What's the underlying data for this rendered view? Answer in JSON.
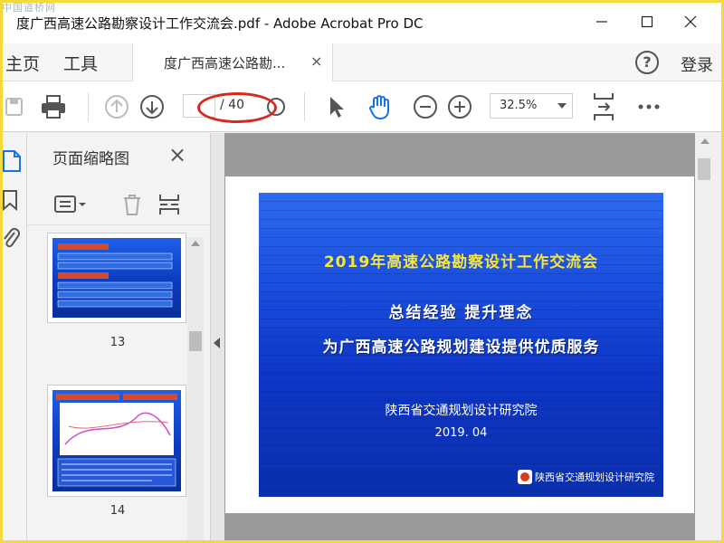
{
  "window": {
    "watermark": "中国道桥网",
    "title": "度广西高速公路勘察设计工作交流会.pdf - Adobe Acrobat Pro DC",
    "minimize_icon": "minimize-icon",
    "maximize_icon": "maximize-icon",
    "close_icon": "close-icon"
  },
  "menu": {
    "home": "主页",
    "tools": "工具",
    "doc_tab_label": "度广西高速公路勘...",
    "doc_tab_close": "×",
    "help": "?",
    "login": "登录"
  },
  "toolbar": {
    "page_current": "",
    "page_total": "/ 40",
    "zoom": "32.5%",
    "icons": [
      "save-icon",
      "print-icon",
      "prev-page-icon",
      "next-page-icon",
      "select-cursor-icon",
      "hand-tool-icon",
      "zoom-out-icon",
      "zoom-in-icon",
      "fit-page-icon",
      "more-icon"
    ]
  },
  "side_panel": {
    "title": "页面缩略图",
    "close": "×",
    "thumbnails": [
      {
        "page": "13"
      },
      {
        "page": "14"
      }
    ]
  },
  "slide": {
    "heading": "2019年高速公路勘察设计工作交流会",
    "subtitle_line1": "总结经验  提升理念",
    "subtitle_line2": "为广西高速公路规划建设提供优质服务",
    "organization": "陕西省交通规划设计研究院",
    "date": "2019. 04",
    "footer": "陕西省交通规划设计研究院"
  },
  "colors": {
    "highlight": "#d9281e",
    "hand_tool_active": "#1473e6",
    "slide_heading": "#f6e53a",
    "frame": "#f4d93b"
  }
}
